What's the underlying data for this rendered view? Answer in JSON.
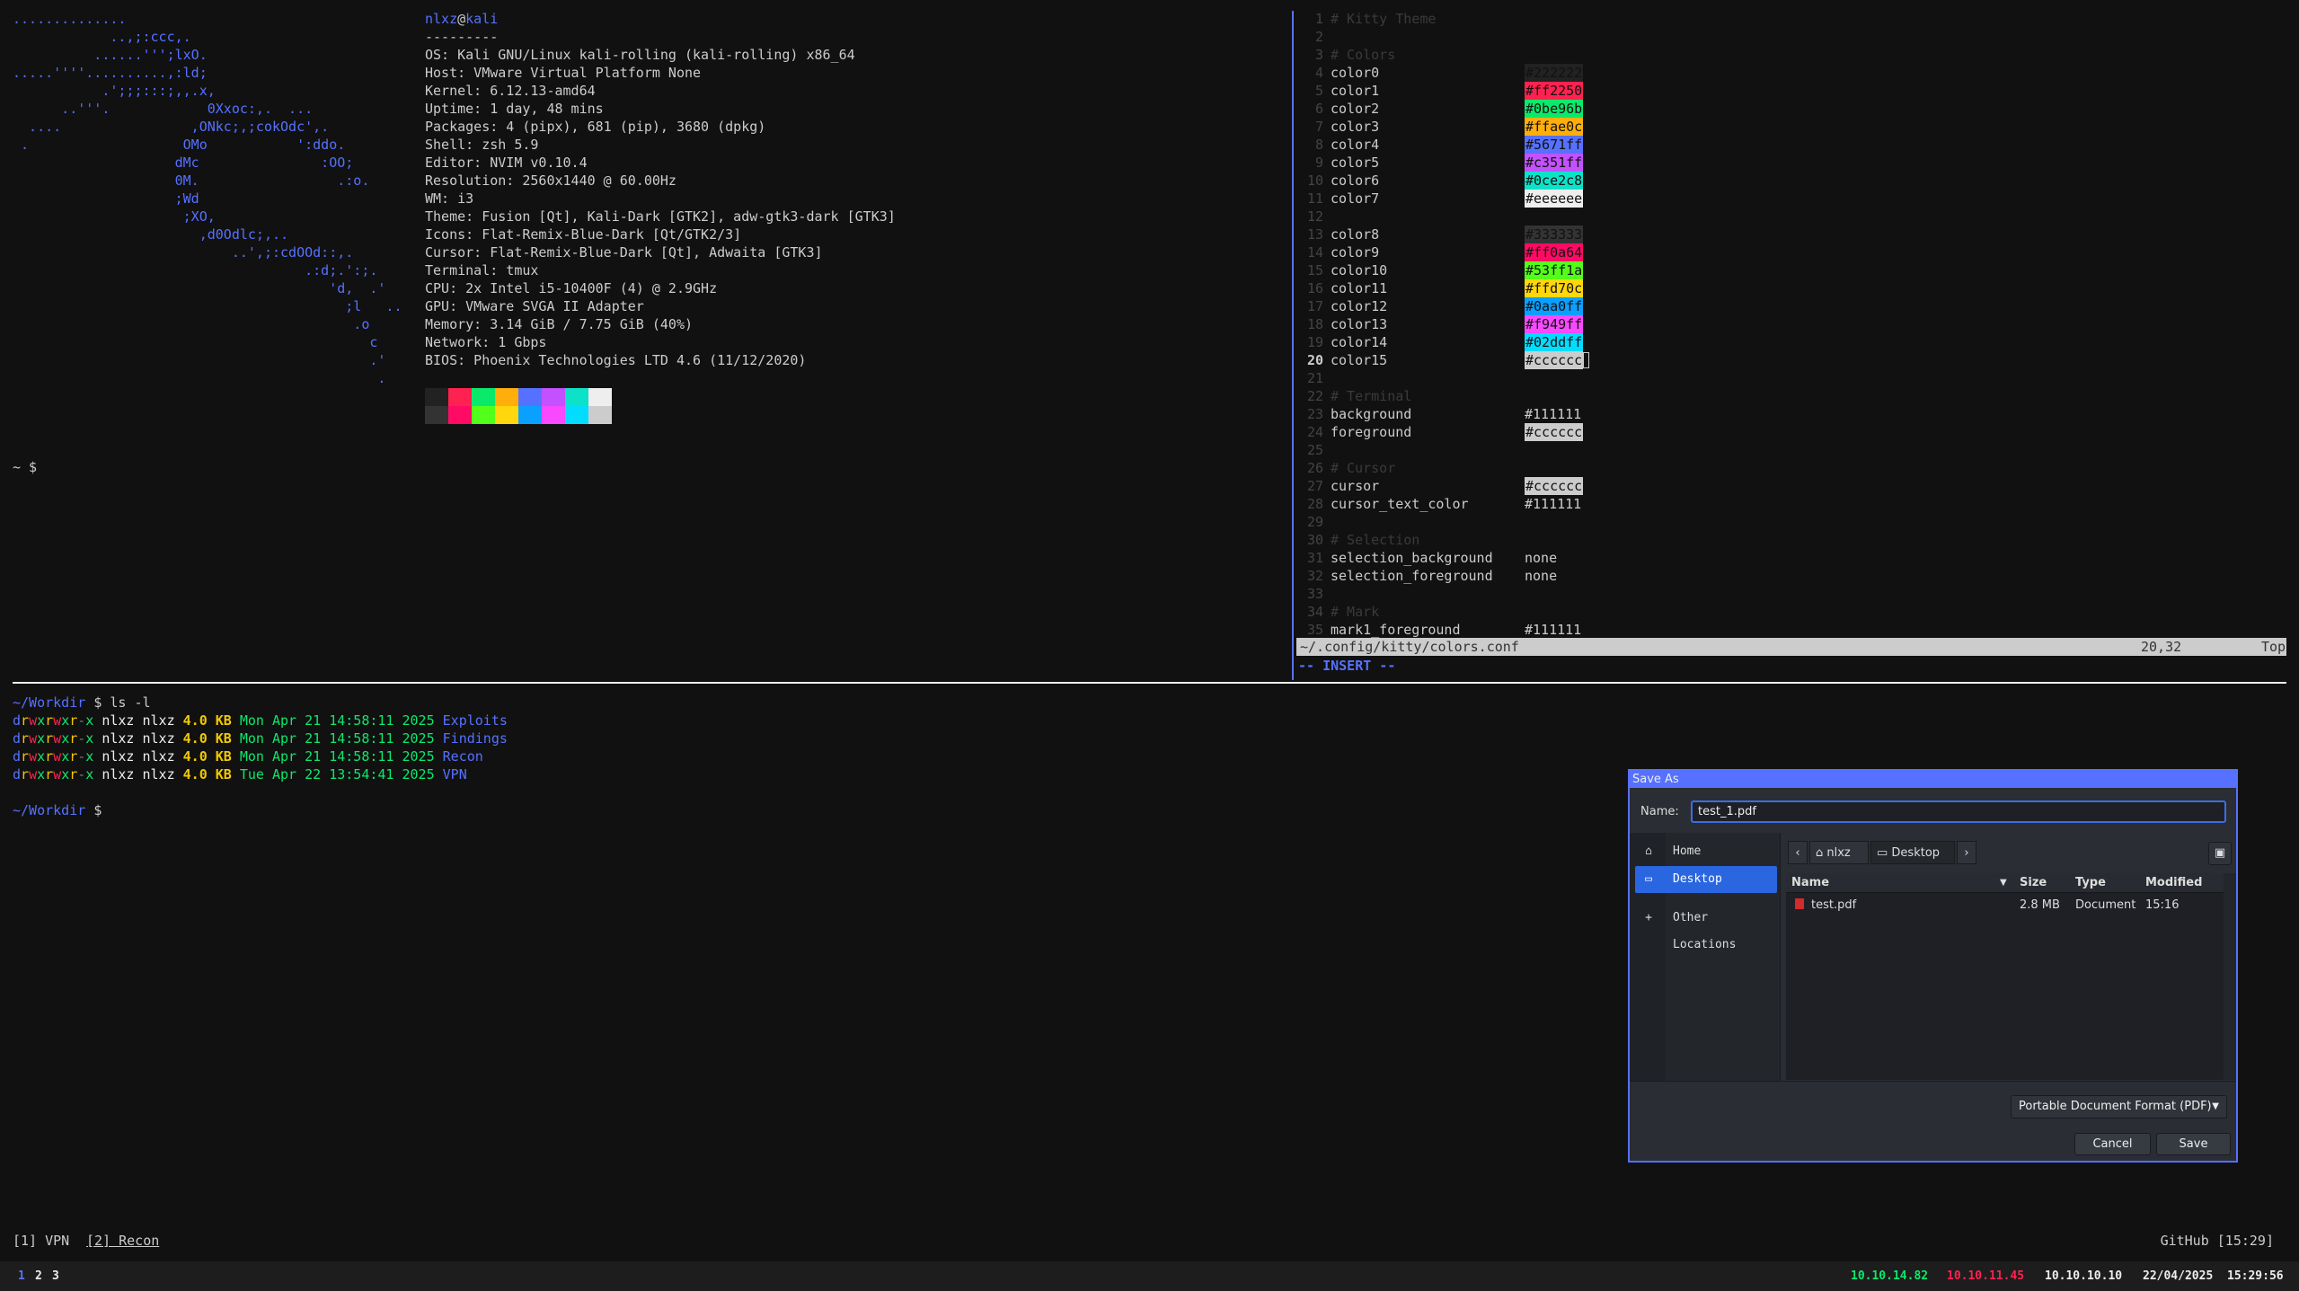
{
  "fetch": {
    "ascii_art": "..............\n            ..,;:ccc,.\n          ......''';lxO.\n.....''''..........,:ld;\n           .';;;:::;,,.x,\n      ..'''.            0Xxoc:,.  ...\n  ....                ,ONkc;,;cokOdc',.\n .                   OMo           ':ddo.\n                    dMc               :OO;\n                    0M.                 .:o.\n                    ;Wd\n                     ;XO,\n                       ,d0Odlc;,..\n                           ..',;:cdOOd::,.\n                                    .:d;.':;.\n                                       'd,  .'\n                                         ;l   ..\n                                          .o\n                                            c\n                                            .'\n                                             .",
    "user": "nlxz",
    "at": "@",
    "host": "kali",
    "separator": "---------",
    "lines": [
      "OS: Kali GNU/Linux kali-rolling (kali-rolling) x86_64",
      "Host: VMware Virtual Platform None",
      "Kernel: 6.12.13-amd64",
      "Uptime: 1 day, 48 mins",
      "Packages: 4 (pipx), 681 (pip), 3680 (dpkg)",
      "Shell: zsh 5.9",
      "Editor: NVIM v0.10.4",
      "Resolution: 2560x1440 @ 60.00Hz",
      "WM: i3",
      "Theme: Fusion [Qt], Kali-Dark [GTK2], adw-gtk3-dark [GTK3]",
      "Icons: Flat-Remix-Blue-Dark [Qt/GTK2/3]",
      "Cursor: Flat-Remix-Blue-Dark [Qt], Adwaita [GTK3]",
      "Terminal: tmux",
      "CPU: 2x Intel i5-10400F (4) @ 2.9GHz",
      "GPU: VMware SVGA II Adapter",
      "Memory: 3.14 GiB / 7.75 GiB (40%)",
      "Network: 1 Gbps",
      "BIOS: Phoenix Technologies LTD 4.6 (11/12/2020)"
    ],
    "palette_top": [
      "#222222",
      "#ff2250",
      "#0be96b",
      "#ffae0c",
      "#5671ff",
      "#c351ff",
      "#0ce2c8",
      "#eeeeee"
    ],
    "palette_bottom": [
      "#333333",
      "#ff0a64",
      "#53ff1a",
      "#ffd70c",
      "#0aa0ff",
      "#f949ff",
      "#02ddff",
      "#cccccc"
    ],
    "prompt": "~ $"
  },
  "vim": {
    "lines": [
      {
        "n": "1",
        "comment": "# Kitty Theme"
      },
      {
        "n": "2"
      },
      {
        "n": "3",
        "comment": "# Colors"
      },
      {
        "n": "4",
        "key": "color0",
        "val": "#222222",
        "swatch": "#222222"
      },
      {
        "n": "5",
        "key": "color1",
        "val": "#ff2250",
        "swatch": "#ff2250"
      },
      {
        "n": "6",
        "key": "color2",
        "val": "#0be96b",
        "swatch": "#0be96b"
      },
      {
        "n": "7",
        "key": "color3",
        "val": "#ffae0c",
        "swatch": "#ffae0c"
      },
      {
        "n": "8",
        "key": "color4",
        "val": "#5671ff",
        "swatch": "#5671ff"
      },
      {
        "n": "9",
        "key": "color5",
        "val": "#c351ff",
        "swatch": "#c351ff"
      },
      {
        "n": "10",
        "key": "color6",
        "val": "#0ce2c8",
        "swatch": "#0ce2c8"
      },
      {
        "n": "11",
        "key": "color7",
        "val": "#eeeeee",
        "swatch": "#eeeeee"
      },
      {
        "n": "12"
      },
      {
        "n": "13",
        "key": "color8",
        "val": "#333333",
        "swatch": "#333333"
      },
      {
        "n": "14",
        "key": "color9",
        "val": "#ff0a64",
        "swatch": "#ff0a64"
      },
      {
        "n": "15",
        "key": "color10",
        "val": "#53ff1a",
        "swatch": "#53ff1a"
      },
      {
        "n": "16",
        "key": "color11",
        "val": "#ffd70c",
        "swatch": "#ffd70c"
      },
      {
        "n": "17",
        "key": "color12",
        "val": "#0aa0ff",
        "swatch": "#0aa0ff"
      },
      {
        "n": "18",
        "key": "color13",
        "val": "#f949ff",
        "swatch": "#f949ff"
      },
      {
        "n": "19",
        "key": "color14",
        "val": "#02ddff",
        "swatch": "#02ddff"
      },
      {
        "n": "20",
        "key": "color15",
        "val": "#cccccc",
        "swatch": "#cccccc",
        "current": true
      },
      {
        "n": "21"
      },
      {
        "n": "22",
        "comment": "# Terminal"
      },
      {
        "n": "23",
        "key": "background",
        "val": "#111111"
      },
      {
        "n": "24",
        "key": "foreground",
        "val": "#cccccc",
        "swatch": "#cccccc"
      },
      {
        "n": "25"
      },
      {
        "n": "26",
        "comment": "# Cursor"
      },
      {
        "n": "27",
        "key": "cursor",
        "val": "#cccccc",
        "swatch": "#cccccc"
      },
      {
        "n": "28",
        "key": "cursor_text_color",
        "val": "#111111"
      },
      {
        "n": "29"
      },
      {
        "n": "30",
        "comment": "# Selection"
      },
      {
        "n": "31",
        "key": "selection_background",
        "val": "none"
      },
      {
        "n": "32",
        "key": "selection_foreground",
        "val": "none"
      },
      {
        "n": "33"
      },
      {
        "n": "34",
        "comment": "# Mark"
      },
      {
        "n": "35",
        "key": "mark1_foreground",
        "val": "#111111"
      }
    ],
    "status_file": "~/.config/kitty/colors.conf",
    "status_pos": "20,32",
    "status_top": "Top",
    "mode": "-- INSERT --"
  },
  "workdir": {
    "prompt_path": "~/Workdir",
    "prompt_sym": "$",
    "command": "ls -l",
    "entries": [
      {
        "perm": "drwxrwxr-x",
        "owner": "nlxz",
        "group": "nlxz",
        "size": "4.0 KB",
        "date": "Mon Apr 21 14:58:11 2025",
        "name": "Exploits"
      },
      {
        "perm": "drwxrwxr-x",
        "owner": "nlxz",
        "group": "nlxz",
        "size": "4.0 KB",
        "date": "Mon Apr 21 14:58:11 2025",
        "name": "Findings"
      },
      {
        "perm": "drwxrwxr-x",
        "owner": "nlxz",
        "group": "nlxz",
        "size": "4.0 KB",
        "date": "Mon Apr 21 14:58:11 2025",
        "name": "Recon"
      },
      {
        "perm": "drwxrwxr-x",
        "owner": "nlxz",
        "group": "nlxz",
        "size": "4.0 KB",
        "date": "Tue Apr 22 13:54:41 2025",
        "name": "VPN"
      }
    ]
  },
  "tmux": {
    "win1": "[1] VPN",
    "win2": "[2] Recon",
    "right": "GitHub [15:29]"
  },
  "i3bar": {
    "workspaces": [
      "1",
      "2",
      "3"
    ],
    "active_workspace": "1",
    "ip_vpn": "10.10.14.82",
    "ip_target": "10.10.11.45",
    "ip_local": "10.10.10.10",
    "date": "22/04/2025",
    "time": "15:29:56"
  },
  "dialog": {
    "title": "Save As",
    "name_label": "Name:",
    "name_value": "test_1.pdf",
    "sidebar": [
      {
        "icon": "home-icon",
        "glyph": "⌂",
        "label": "Home",
        "selected": false
      },
      {
        "icon": "desktop-icon",
        "glyph": "▭",
        "label": "Desktop",
        "selected": true
      },
      {
        "icon": "plus-icon",
        "glyph": "+",
        "label": "Other Locations",
        "selected": false
      }
    ],
    "path_back": "‹",
    "path_home": "nlxz",
    "path_current": "Desktop",
    "path_forward": "›",
    "columns": {
      "name": "Name",
      "size": "Size",
      "type": "Type",
      "modified": "Modified"
    },
    "files": [
      {
        "name": "test.pdf",
        "size": "2.8 MB",
        "type": "Document",
        "modified": "15:16"
      }
    ],
    "filter": "Portable Document Format (PDF)",
    "cancel": "Cancel",
    "save": "Save"
  }
}
